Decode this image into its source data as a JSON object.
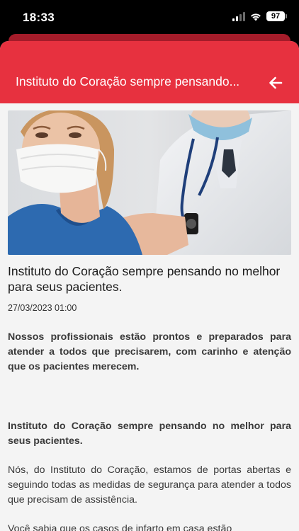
{
  "status_bar": {
    "time": "18:33",
    "battery": "97"
  },
  "header": {
    "title": "Instituto do Coração sempre pensando...",
    "back_icon": "arrow-left-icon"
  },
  "colors": {
    "accent": "#e7313f",
    "background": "#f4f4f4"
  },
  "article": {
    "image": "doctor-listening-to-masked-patient-photo",
    "title": "Instituto do Coração sempre pensando no melhor para seus pacientes.",
    "date": "27/03/2023 01:00",
    "paragraphs": {
      "lead": "Nossos profissionais estão prontos e preparados para atender a todos que precisarem, com carinho e atenção que os pacientes merecem.",
      "heading": "Instituto do Coração sempre pensando no melhor para seus pacientes.",
      "body1": "Nós, do Instituto do Coração, estamos de portas abertas e seguindo todas as medidas de segurança para atender a todos que precisam de assistência.",
      "body2": "Você sabia que os casos de infarto em casa estão"
    }
  }
}
